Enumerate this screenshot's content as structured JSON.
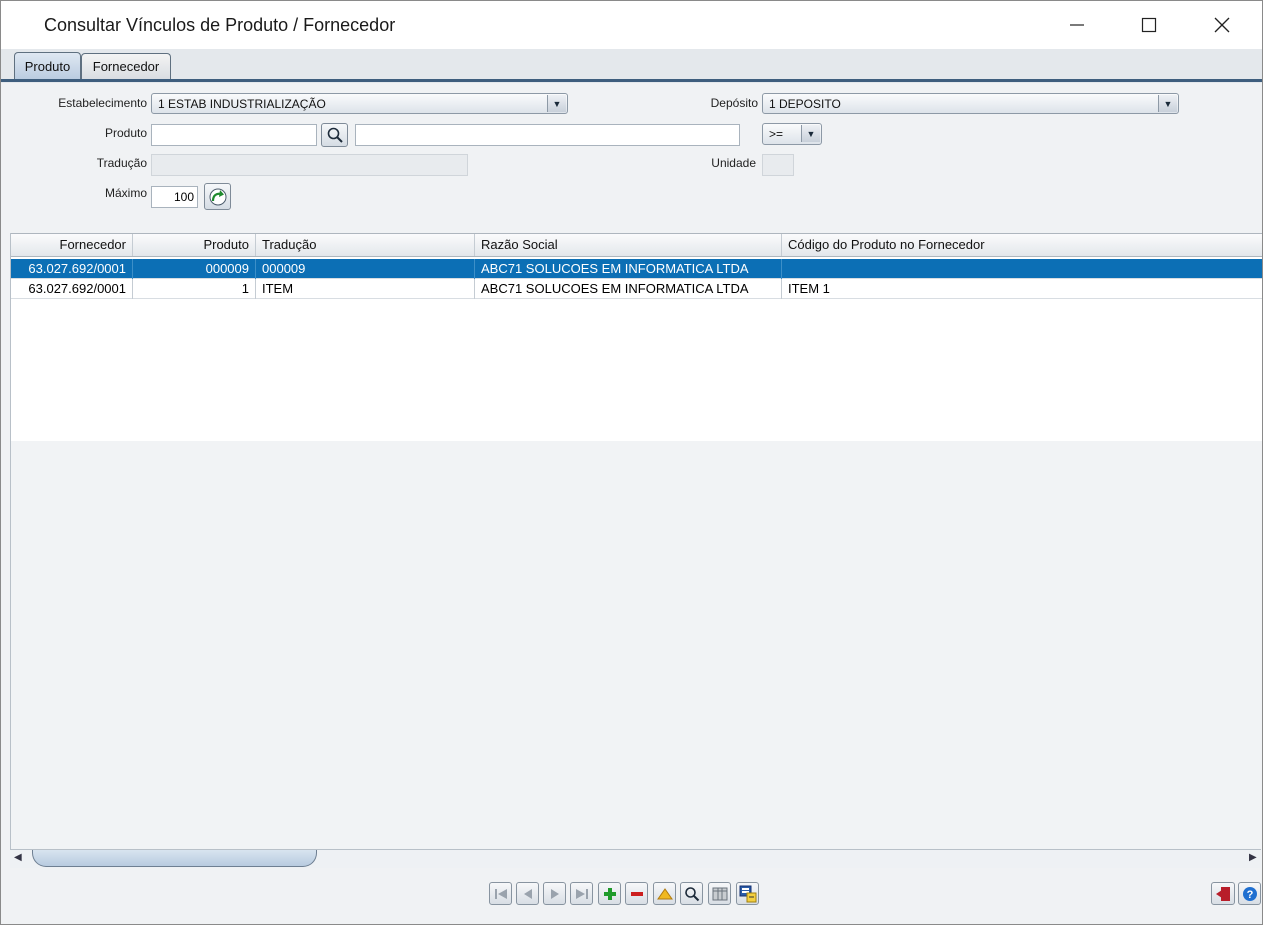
{
  "window": {
    "title": "Consultar Vínculos de Produto / Fornecedor",
    "minimize": "—",
    "maximize": "☐",
    "close": "✕"
  },
  "tabs": [
    {
      "label": "Produto",
      "active": true
    },
    {
      "label": "Fornecedor",
      "active": false
    }
  ],
  "form": {
    "estabelecimento_label": "Estabelecimento",
    "estabelecimento_value": "1 ESTAB INDUSTRIALIZAÇÃO",
    "deposito_label": "Depósito",
    "deposito_value": "1 DEPOSITO",
    "produto_label": "Produto",
    "produto_code": "",
    "produto_desc": "",
    "operator_value": ">=",
    "traducao_label": "Tradução",
    "unidade_label": "Unidade",
    "maximo_label": "Máximo",
    "maximo_value": "100"
  },
  "grid": {
    "columns": [
      "Fornecedor",
      "Produto",
      "Tradução",
      "Razão Social",
      "Código do Produto no Fornecedor"
    ],
    "rows": [
      {
        "fornecedor": "63.027.692/0001",
        "produto": "000009",
        "traducao": "000009",
        "razao_social": "ABC71 SOLUCOES EM INFORMATICA LTDA",
        "codigo": "",
        "selected": true
      },
      {
        "fornecedor": "63.027.692/0001",
        "produto": "1",
        "traducao": "ITEM",
        "razao_social": "ABC71 SOLUCOES EM INFORMATICA LTDA",
        "codigo": "ITEM 1",
        "selected": false
      }
    ]
  },
  "toolbar": {
    "icons": [
      "first-record-icon",
      "previous-record-icon",
      "next-record-icon",
      "last-record-icon",
      "add-record-icon",
      "remove-record-icon",
      "edit-record-icon",
      "search-icon",
      "columns-icon",
      "export-icon"
    ],
    "exit_icon": "exit-icon",
    "help_icon": "help-icon"
  },
  "colors": {
    "selection": "#0c6fb5",
    "tab_border": "#3e5e7e"
  }
}
